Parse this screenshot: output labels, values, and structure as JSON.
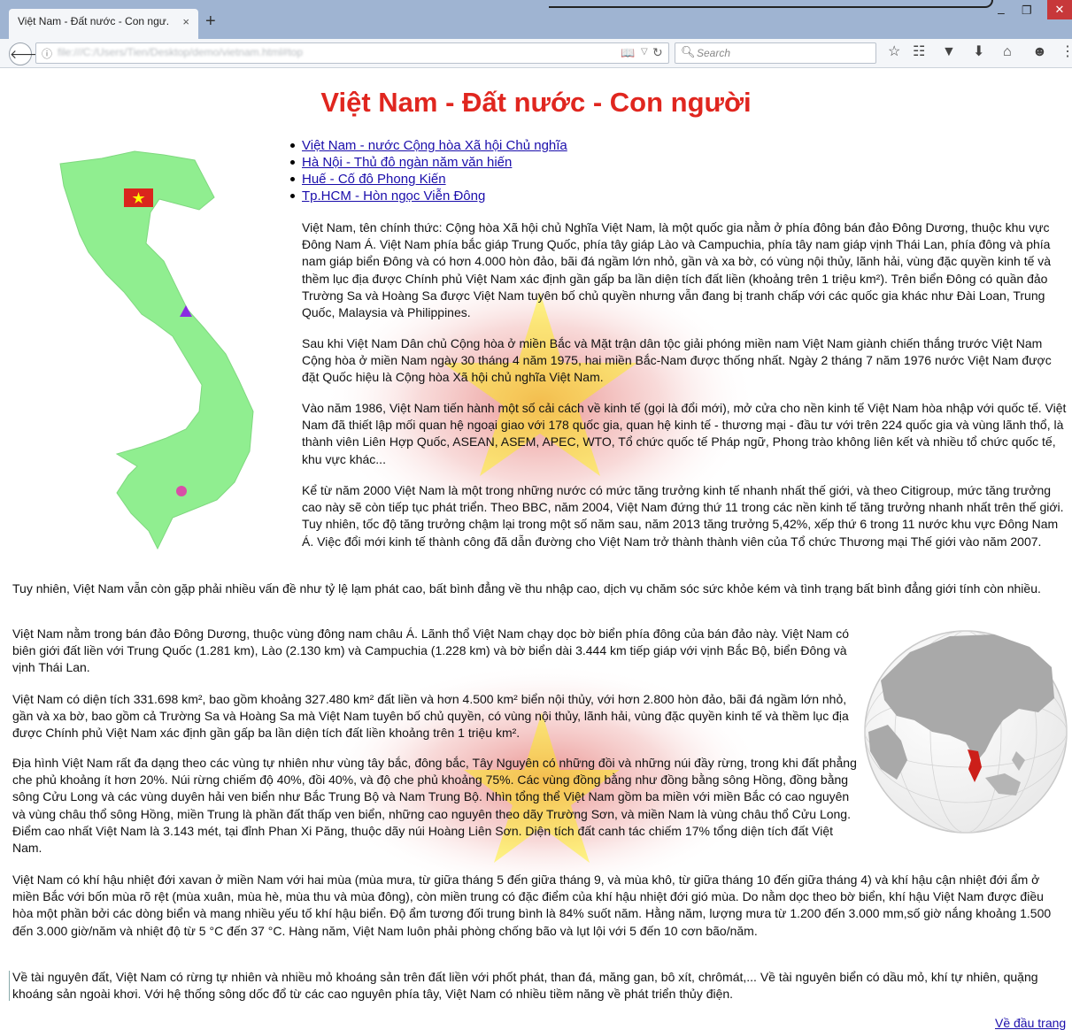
{
  "browser": {
    "tab_title": "Việt Nam - Đất nước - Con ngư...",
    "tab_close": "×",
    "new_tab": "+",
    "url": "file:///C:/Users/Tien/Desktop/demo/vietnam.html#top",
    "search_placeholder": "Search",
    "window_min": "–",
    "window_max": "❐",
    "window_close": "✕",
    "icons": [
      "back-icon",
      "info-icon",
      "reader-icon",
      "reload-icon",
      "search-icon",
      "bookmark-star-icon",
      "library-icon",
      "pocket-icon",
      "download-icon",
      "home-icon",
      "chat-icon",
      "menu-icon"
    ]
  },
  "page": {
    "title": "Việt Nam - Đất nước - Con người",
    "nav_links": [
      "Việt Nam - nước Cộng hòa Xã hội Chủ nghĩa",
      "Hà Nội - Thủ đô ngàn năm văn hiến",
      "Huế - Cố đô Phong Kiến",
      "Tp.HCM - Hòn ngọc Viễn Đông"
    ],
    "paragraphs": [
      "Việt Nam, tên chính thức: Cộng hòa Xã hội chủ Nghĩa Việt Nam, là một quốc gia nằm ở phía đông bán đảo Đông Dương, thuộc khu vực Đông Nam Á. Việt Nam phía bắc giáp Trung Quốc, phía tây giáp Lào và Campuchia, phía tây nam giáp vịnh Thái Lan, phía đông và phía nam giáp biển Đông và có hơn 4.000 hòn đảo, bãi đá ngầm lớn nhỏ, gần và xa bờ, có vùng nội thủy, lãnh hải, vùng đặc quyền kinh tế và thềm lục địa được Chính phủ Việt Nam xác định gần gấp ba lần diện tích đất liền (khoảng trên 1 triệu km²). Trên biển Đông có quần đảo Trường Sa và Hoàng Sa được Việt Nam tuyên bố chủ quyền nhưng vẫn đang bị tranh chấp với các quốc gia khác như Đài Loan, Trung Quốc, Malaysia và Philippines.",
      "Sau khi Việt Nam Dân chủ Cộng hòa ở miền Bắc và Mặt trận dân tộc giải phóng miền nam Việt Nam giành chiến thắng trước Việt Nam Cộng hòa ở miền Nam ngày 30 tháng 4 năm 1975, hai miền Bắc-Nam được thống nhất. Ngày 2 tháng 7 năm 1976 nước Việt Nam được đặt Quốc hiệu là Cộng hòa Xã hội chủ nghĩa Việt Nam.",
      "Vào năm 1986, Việt Nam tiến hành một số cải cách về kinh tế (gọi là đổi mới), mở cửa cho nền kinh tế Việt Nam hòa nhập với quốc tế. Việt Nam đã thiết lập mối quan hệ ngoại giao với 178 quốc gia, quan hệ kinh tế - thương mại - đầu tư với trên 224 quốc gia và vùng lãnh thổ, là thành viên Liên Hợp Quốc, ASEAN, ASEM, APEC, WTO, Tổ chức quốc tế Pháp ngữ, Phong trào không liên kết và nhiều tổ chức quốc tế, khu vực khác...",
      "Kể từ năm 2000 Việt Nam là một trong những nước có mức tăng trưởng kinh tế nhanh nhất thế giới, và theo Citigroup, mức tăng trưởng cao này sẽ còn tiếp tục phát triển. Theo BBC, năm 2004, Việt Nam đứng thứ 11 trong các nền kinh tế tăng trưởng nhanh nhất trên thế giới. Tuy nhiên, tốc độ tăng trưởng chậm lại trong một số năm sau, năm 2013 tăng trưởng 5,42%, xếp thứ 6 trong 11 nước khu vực Đông Nam Á. Việc đổi mới kinh tế thành công đã dẫn đường cho Việt Nam trở thành thành viên của Tổ chức Thương mại Thế giới vào năm 2007.",
      "Tuy nhiên, Việt Nam vẫn còn gặp phải nhiều vấn đề như tỷ lệ lạm phát cao, bất bình đẳng về thu nhập cao, dịch vụ chăm sóc sức khỏe kém và tình trạng bất bình đẳng giới tính còn nhiều.",
      "Việt Nam nằm trong bán đảo Đông Dương, thuộc vùng đông nam châu Á. Lãnh thổ Việt Nam chạy dọc bờ biển phía đông của bán đảo này. Việt Nam có biên giới đất liền với Trung Quốc (1.281 km), Lào (2.130 km) và Campuchia (1.228 km) và bờ biển dài 3.444 km tiếp giáp với vịnh Bắc Bộ, biển Đông và vịnh Thái Lan.",
      "Việt Nam có diện tích 331.698 km², bao gồm khoảng 327.480 km² đất liền và hơn 4.500 km² biển nội thủy, với hơn 2.800 hòn đảo, bãi đá ngầm lớn nhỏ, gần và xa bờ, bao gồm cả Trường Sa và Hoàng Sa mà Việt Nam tuyên bố chủ quyền, có vùng nội thủy, lãnh hải, vùng đặc quyền kinh tế và thềm lục địa được Chính phủ Việt Nam xác định gần gấp ba lần diện tích đất liền khoảng trên 1 triệu km².",
      "Địa hình Việt Nam rất đa dạng theo các vùng tự nhiên như vùng tây bắc, đông bắc, Tây Nguyên có những đồi và những núi đầy rừng, trong khi đất phẳng che phủ khoảng ít hơn 20%. Núi rừng chiếm độ 40%, đồi 40%, và độ che phủ khoảng 75%. Các vùng đồng bằng như đồng bằng sông Hồng, đồng bằng sông Cửu Long và các vùng duyên hải ven biển như Bắc Trung Bộ và Nam Trung Bộ. Nhìn tổng thể Việt Nam gồm ba miền với miền Bắc có cao nguyên và vùng châu thổ sông Hồng, miền Trung là phần đất thấp ven biển, những cao nguyên theo dãy Trường Sơn, và miền Nam là vùng châu thổ Cửu Long. Điểm cao nhất Việt Nam là 3.143 mét, tại đỉnh Phan Xi Păng, thuộc dãy núi Hoàng Liên Sơn. Diện tích đất canh tác chiếm 17% tổng diện tích đất Việt Nam.",
      "Việt Nam có khí hậu nhiệt đới xavan ở miền Nam với hai mùa (mùa mưa, từ giữa tháng 5 đến giữa tháng 9, và mùa khô, từ giữa tháng 10 đến giữa tháng 4) và khí hậu cận nhiệt đới ẩm ở miền Bắc với bốn mùa rõ rệt (mùa xuân, mùa hè, mùa thu và mùa đông), còn miền trung có đặc điểm của khí hậu nhiệt đới gió mùa. Do nằm dọc theo bờ biển, khí hậu Việt Nam được điều hòa một phần bởi các dòng biển và mang nhiều yếu tố khí hậu biển. Độ ẩm tương đối trung bình là 84% suốt năm. Hằng năm, lượng mưa từ 1.200 đến 3.000 mm,số giờ nắng khoảng 1.500 đến 3.000 giờ/năm và nhiệt độ từ 5 °C đến 37 °C. Hàng năm, Việt Nam luôn phải phòng chống bão và lụt lội với 5 đến 10 cơn bão/năm.",
      "Về tài nguyên đất, Việt Nam có rừng tự nhiên và nhiều mỏ khoáng sản trên đất liền với phốt phát, than đá, măng gan, bô xít, chrômát,... Về tài nguyên biển có dầu mỏ, khí tự nhiên, quặng khoáng sản ngoài khơi. Với hệ thống sông dốc đổ từ các cao nguyên phía tây, Việt Nam có nhiều tiềm năng về phát triển thủy điện."
    ],
    "back_to_top": "Về đầu trang",
    "colors": {
      "title": "#e0261f",
      "map_land": "#90ee90",
      "flag_red": "#da251d",
      "flag_star": "#ffff00"
    }
  }
}
